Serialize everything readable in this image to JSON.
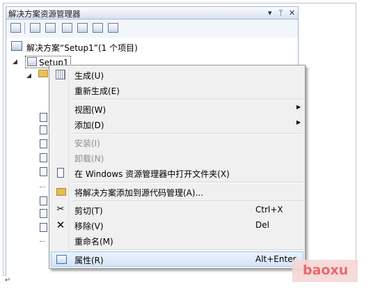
{
  "panel": {
    "title": "解决方案资源管理器",
    "controls": {
      "dropdown": "▾",
      "pin": "ᛘ",
      "close": "✕"
    }
  },
  "toolbar": {
    "icons": [
      "properties-icon",
      "show-all-files-icon",
      "refresh-icon",
      "file-system-editor-icon",
      "registry-editor-icon",
      "file-types-editor-icon",
      "custom-actions-editor-icon"
    ]
  },
  "tree": {
    "solution_label": "解决方案“Setup1”(1 个项目)",
    "project_label": "Setup1"
  },
  "context_menu": {
    "items": [
      {
        "label": "生成(U)",
        "icon": "build-icon",
        "enabled": true
      },
      {
        "label": "重新生成(E)",
        "enabled": true
      },
      {
        "label": "视图(W)",
        "submenu": true,
        "enabled": true
      },
      {
        "label": "添加(D)",
        "submenu": true,
        "enabled": true
      },
      {
        "label": "安装(I)",
        "enabled": false
      },
      {
        "label": "卸载(N)",
        "enabled": false
      },
      {
        "label": "在 Windows 资源管理器中打开文件夹(X)",
        "icon": "open-folder-explorer-icon",
        "enabled": true
      },
      {
        "label": "将解决方案添加到源代码管理(A)...",
        "icon": "source-control-icon",
        "enabled": true
      },
      {
        "label": "剪切(T)",
        "shortcut": "Ctrl+X",
        "icon": "scissors-icon",
        "enabled": true
      },
      {
        "label": "移除(V)",
        "shortcut": "Del",
        "icon": "remove-x-icon",
        "enabled": true
      },
      {
        "label": "重命名(M)",
        "enabled": true
      },
      {
        "label": "属性(R)",
        "shortcut": "Alt+Enter",
        "icon": "properties-icon",
        "enabled": true,
        "highlighted": true
      }
    ]
  },
  "glyphs": {
    "submenu_arrow": "▶",
    "cut": "✂",
    "remove": "✕",
    "expanded": "◢"
  },
  "watermark": "baoxu",
  "paragraph_mark": "↵"
}
